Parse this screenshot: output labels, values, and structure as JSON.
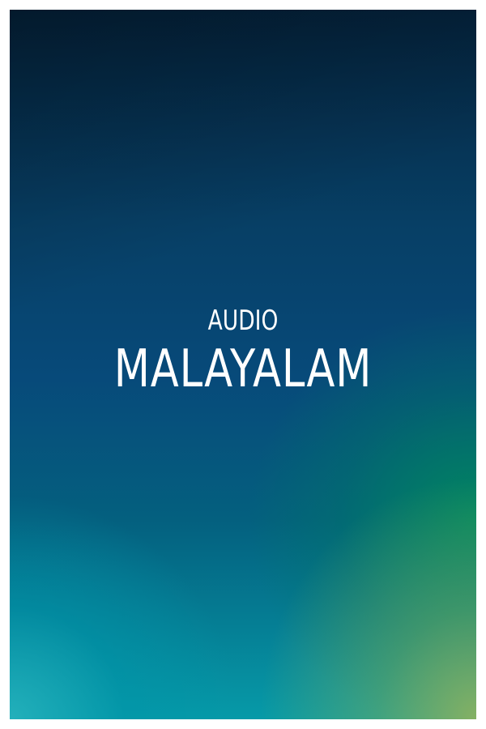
{
  "poster": {
    "subtitle": "AUDIO",
    "title": "MALAYALAM"
  },
  "colors": {
    "top": "#04223b",
    "middle": "#074a7a",
    "green_accent": "#00885c",
    "bottom_left": "#28b4be",
    "bottom_right": "#8cb260",
    "text": "#ffffff",
    "frame": "#ffffff"
  }
}
